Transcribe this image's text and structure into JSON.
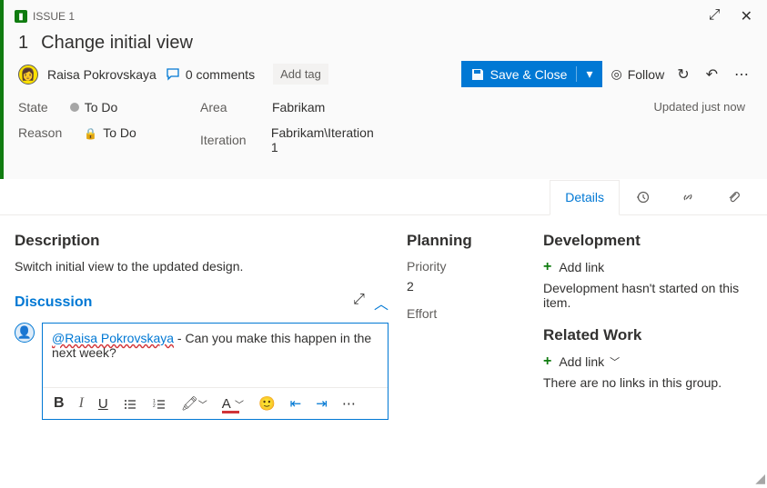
{
  "header": {
    "type_label": "ISSUE 1",
    "id": "1",
    "title": "Change initial view"
  },
  "toolbar": {
    "assignee": "Raisa Pokrovskaya",
    "comments_text": "0 comments",
    "add_tag": "Add tag",
    "save_label": "Save & Close",
    "follow_label": "Follow"
  },
  "fields": {
    "state_label": "State",
    "state_value": "To Do",
    "reason_label": "Reason",
    "reason_value": "To Do",
    "area_label": "Area",
    "area_value": "Fabrikam",
    "iteration_label": "Iteration",
    "iteration_value": "Fabrikam\\Iteration 1",
    "updated_text": "Updated just now"
  },
  "tabs": {
    "details": "Details"
  },
  "description": {
    "heading": "Description",
    "text": "Switch initial view to the updated design."
  },
  "discussion": {
    "heading": "Discussion",
    "mention": "@Raisa Pokrovskaya",
    "text_after": " - Can you make this happen in the next week?"
  },
  "planning": {
    "heading": "Planning",
    "priority_label": "Priority",
    "priority_value": "2",
    "effort_label": "Effort"
  },
  "development": {
    "heading": "Development",
    "add_link": "Add link",
    "empty_text": "Development hasn't started on this item."
  },
  "related": {
    "heading": "Related Work",
    "add_link": "Add link",
    "empty_text": "There are no links in this group."
  }
}
